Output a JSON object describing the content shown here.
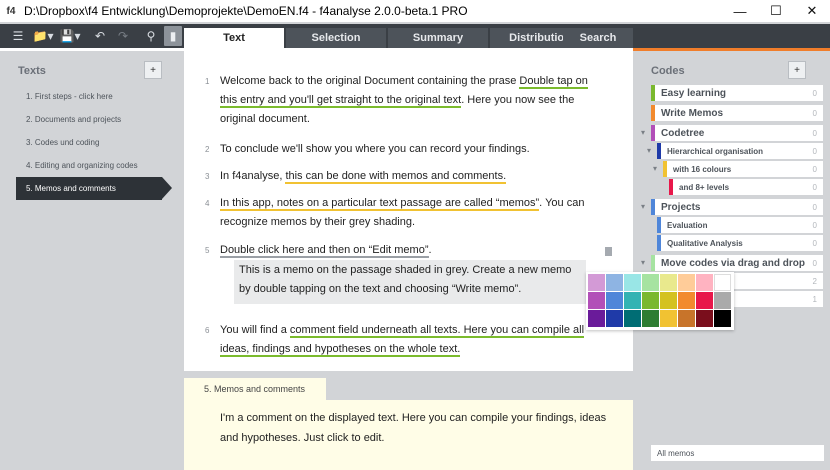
{
  "window": {
    "title": "D:\\Dropbox\\f4 Entwicklung\\Demoprojekte\\DemoEN.f4 - f4analyse 2.0.0-beta.1 PRO",
    "app_icon": "f4"
  },
  "toolbar": {
    "tabs": [
      "Text",
      "Selection",
      "Summary",
      "Distribution"
    ],
    "search_label": "Search"
  },
  "left_panel": {
    "title": "Texts",
    "add_label": "+",
    "items": [
      "1. First steps - click here",
      "2. Documents and projects",
      "3. Codes und coding",
      "4. Editing and organizing codes",
      "5. Memos and comments"
    ],
    "active_index": 4
  },
  "document": {
    "paragraphs": [
      {
        "num": "1",
        "pre": "Welcome back to the original Document containing the prase ",
        "link": "Double tap on this entry and you'll get straight to the original text",
        "post": ". Here you now see the original document."
      },
      {
        "num": "2",
        "text": "To conclude we'll show you where you can record your findings."
      },
      {
        "num": "3",
        "pre": "In f4analyse, ",
        "mark": "this can be done with memos and comments.",
        "post": ""
      },
      {
        "num": "4",
        "mark": "In this app, notes on a particular text passage are called “memos”",
        "post": ". You can recognize memos by their grey shading."
      },
      {
        "num": "5",
        "mark": "Double click here and then on “Edit memo”",
        "post": "."
      },
      {
        "num": "6",
        "pre": "You will find a ",
        "mark": "comment field underneath all texts. Here you can compile all ideas, findings and hypotheses on the whole text.",
        "post": ""
      }
    ],
    "memo": "This is a memo on the passage shaded in grey. Create a new memo by double tapping on the text and choosing “Write memo”."
  },
  "color_picker": {
    "colors": [
      "#d39ad6",
      "#8eb4e3",
      "#99e6e6",
      "#a6e3a1",
      "#e9e98d",
      "#ffcc99",
      "#ffb3c1",
      "#ffffff",
      "#b24fb8",
      "#4f86d9",
      "#33b3b3",
      "#7ab82e",
      "#d4c21f",
      "#f28a2e",
      "#e8174a",
      "#aaaaaa",
      "#6a1b9a",
      "#1f3aa8",
      "#006d74",
      "#2e7d32",
      "#f1c232",
      "#c8742a",
      "#7a0e1c",
      "#000000"
    ]
  },
  "comment": {
    "tab_label": "5. Memos and comments",
    "text": "I'm a comment on the displayed text. Here you can compile your findings, ideas and hypotheses. Just click to edit."
  },
  "right_panel": {
    "title": "Codes",
    "add_label": "+",
    "codes": [
      {
        "label": "Easy learning",
        "count": "0",
        "color": "#7ab82e"
      },
      {
        "label": "Write Memos",
        "count": "0",
        "color": "#f28a2e"
      },
      {
        "label": "Codetree",
        "count": "0",
        "color": "#b24fb8"
      },
      {
        "label": "Hierarchical organisation",
        "count": "0",
        "color": "#1f3aa8"
      },
      {
        "label": "with 16 colours",
        "count": "0",
        "color": "#f1c232"
      },
      {
        "label": "and 8+ levels",
        "count": "0",
        "color": "#e8174a"
      },
      {
        "label": "Projects",
        "count": "0",
        "color": "#4f86d9"
      },
      {
        "label": "Evaluation",
        "count": "0",
        "color": "#4f86d9"
      },
      {
        "label": "Qualitative Analysis",
        "count": "0",
        "color": "#4f86d9"
      },
      {
        "label": "Move codes via drag and drop",
        "count": "0",
        "color": "#a6e3a1"
      },
      {
        "label": "",
        "count": "2",
        "color": "#d4c21f"
      },
      {
        "label": "",
        "count": "1",
        "color": "#d4c21f"
      }
    ],
    "all_memos": "All memos"
  }
}
